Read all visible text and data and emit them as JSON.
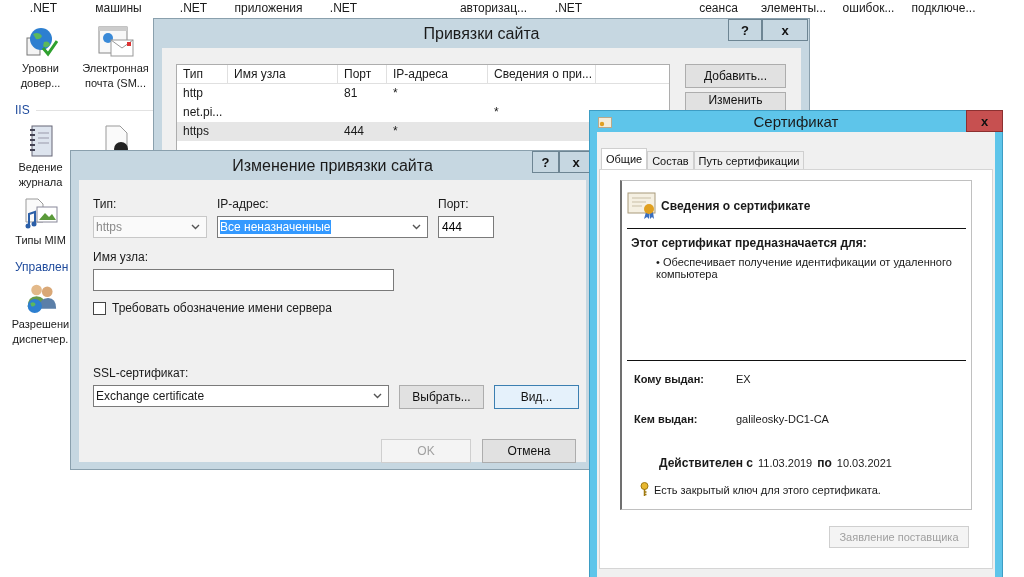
{
  "feature_view": {
    "top_labels": [
      [
        ".NET",
        "машины",
        ".NET",
        "приложения",
        ".NET"
      ],
      [
        "авторизац...",
        ".NET"
      ],
      [
        "сеанса",
        "элементы...",
        "ошибок...",
        "подключе..."
      ]
    ],
    "items": [
      {
        "kind": "trust",
        "label": "Уровни\nдовер..."
      },
      {
        "kind": "email",
        "label": "Электронная\nпочта (SM..."
      }
    ],
    "sections": [
      {
        "title": "IIS",
        "items": [
          {
            "kind": "log",
            "label": "Ведение\nжурнала"
          },
          {
            "kind": "document"
          },
          {
            "kind": "mime",
            "label": "Типы MIM"
          }
        ]
      },
      {
        "title": "Управлен",
        "items": [
          {
            "kind": "permissions",
            "label": "Разрешени\nдиспетчер."
          }
        ]
      }
    ]
  },
  "bindings_window": {
    "title": "Привязки сайта",
    "help_button": "?",
    "close_button": "x",
    "table": {
      "columns": [
        "Тип",
        "Имя узла",
        "Порт",
        "IP-адреса",
        "Сведения о при..."
      ],
      "rows": [
        {
          "type": "http",
          "port": "81",
          "ip": "*",
          "selected": false
        },
        {
          "type": "net.pi...",
          "info": "*",
          "selected": false
        },
        {
          "type": "https",
          "port": "444",
          "ip": "*",
          "selected": true
        }
      ]
    },
    "buttons": [
      "Добавить...",
      "Изменить"
    ]
  },
  "edit_window": {
    "title": "Изменение привязки сайта",
    "help_button": "?",
    "close_button": "x",
    "type": {
      "label": "Тип:",
      "value": "https",
      "disabled": true
    },
    "ip": {
      "label": "IP-адрес:",
      "value": "Все неназначенные",
      "highlighted": true
    },
    "port": {
      "label": "Порт:",
      "value": "444"
    },
    "host": {
      "label": "Имя узла:"
    },
    "sni": {
      "label": "Требовать обозначение имени сервера",
      "checked": false
    },
    "ssl": {
      "label": "SSL-сертификат:",
      "value": "Exchange certificate"
    },
    "select_button": "Выбрать...",
    "view_button": {
      "label": "Вид...",
      "focused": true
    },
    "ok_button": {
      "label": "OK",
      "disabled": true
    },
    "cancel_button": {
      "label": "Отмена",
      "disabled": false
    }
  },
  "cert_window": {
    "title": "Сертификат",
    "close_button": "x",
    "tabs": [
      {
        "label": "Общие",
        "selected": true
      },
      {
        "label": "Состав",
        "selected": false
      },
      {
        "label": "Путь сертификации",
        "selected": false
      }
    ],
    "heading": "Сведения о сертификате",
    "purpose_title": "Этот сертификат предназначается для:",
    "purposes": [
      "• Обеспечивает получение идентификации от удаленного компьютера"
    ],
    "issued_to": {
      "label": "Кому выдан:",
      "value": "EX"
    },
    "issued_by": {
      "label": "Кем выдан:",
      "value": "galileosky-DC1-CA"
    },
    "validity": {
      "from_label": "Действителен с",
      "from": "11.03.2019",
      "to_label": "по",
      "to": "10.03.2021"
    },
    "private_key_note": "Есть закрытый ключ для этого сертификата.",
    "issuer_statement_button": {
      "label": "Заявление поставщика",
      "disabled": true
    }
  }
}
